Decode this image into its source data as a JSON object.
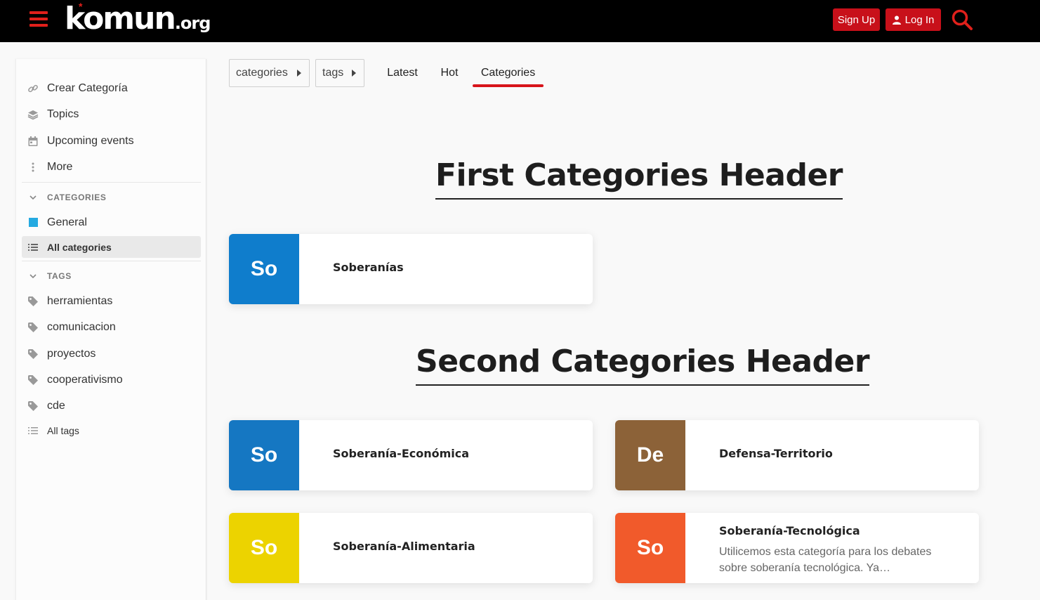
{
  "header": {
    "logo_main": "komun",
    "logo_tld": ".org",
    "signup_label": "Sign Up",
    "login_label": "Log In"
  },
  "sidebar": {
    "links": [
      {
        "label": "Crear Categoría",
        "icon": "link-icon"
      },
      {
        "label": "Topics",
        "icon": "layers-icon"
      },
      {
        "label": "Upcoming events",
        "icon": "calendar-icon"
      },
      {
        "label": "More",
        "icon": "vertical-dots-icon"
      }
    ],
    "categories_heading": "CATEGORIES",
    "categories": [
      {
        "label": "General",
        "color": "#25aae1"
      },
      {
        "label": "All categories",
        "active": true
      }
    ],
    "tags_heading": "TAGS",
    "tags": [
      "herramientas",
      "comunicacion",
      "proyectos",
      "cooperativismo",
      "cde"
    ],
    "all_tags_label": "All tags"
  },
  "nav": {
    "crumb_categories": "categories",
    "crumb_tags": "tags",
    "tabs": [
      {
        "label": "Latest"
      },
      {
        "label": "Hot"
      },
      {
        "label": "Categories",
        "active": true
      }
    ]
  },
  "sections": [
    {
      "header": "First Categories Header",
      "cards": [
        {
          "badge": "So",
          "title": "Soberanías",
          "color": "#0f7dcc"
        }
      ]
    },
    {
      "header": "Second Categories Header",
      "cards": [
        {
          "badge": "So",
          "title": "Soberanía-Económica",
          "color": "#1577c2"
        },
        {
          "badge": "De",
          "title": "Defensa-Territorio",
          "color": "#8c6238"
        },
        {
          "badge": "So",
          "title": "Soberanía-Alimentaria",
          "color": "#ecd300"
        },
        {
          "badge": "So",
          "title": "Soberanía-Tecnológica",
          "description": "Utilicemos esta categoría para los debates sobre soberanía tecnológica. Ya…",
          "color": "#f15a2b"
        }
      ]
    }
  ],
  "colors": {
    "accent": "#d7141b",
    "header_bg": "#000000"
  }
}
